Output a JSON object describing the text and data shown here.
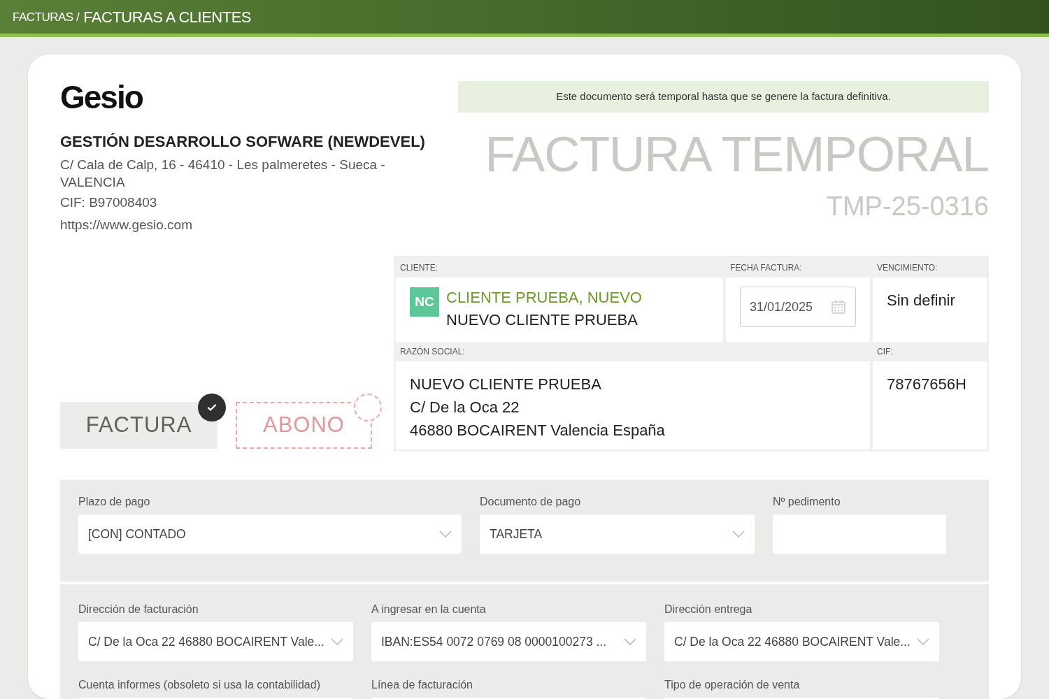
{
  "breadcrumb": {
    "parent": "FACTURAS /",
    "current": "FACTURAS A CLIENTES"
  },
  "company": {
    "logo": "Gesio",
    "name": "GESTIÓN DESARROLLO SOFWARE (NEWDEVEL)",
    "address": "C/ Cala de Calp, 16 - 46410 - Les palmeretes - Sueca - VALENCIA",
    "cif": "CIF: B97008403",
    "web": "https://www.gesio.com"
  },
  "notice": "Este documento será temporal hasta que se genere la factura definitiva.",
  "document": {
    "title": "FACTURA TEMPORAL",
    "number": "TMP-25-0316"
  },
  "document_types": [
    {
      "label": "FACTURA",
      "selected": true
    },
    {
      "label": "ABONO",
      "selected": false
    }
  ],
  "client": {
    "label": "CLIENTE:",
    "initials": "NC",
    "name": "CLIENTE PRUEBA, NUEVO",
    "subname": "NUEVO CLIENTE PRUEBA",
    "date_label": "FECHA FACTURA:",
    "date": "31/01/2025",
    "due_label": "VENCIMIENTO:",
    "due": "Sin definir",
    "business_label": "RAZÓN SOCIAL:",
    "business_lines": [
      "NUEVO CLIENTE PRUEBA",
      "C/ De la Oca 22",
      "46880 BOCAIRENT Valencia España"
    ],
    "cif_label": "CIF:",
    "cif": "78767656H"
  },
  "payment_fields": [
    {
      "label": "Plazo de pago",
      "kind": "select",
      "value": "[CON] CONTADO"
    },
    {
      "label": "Documento de pago",
      "kind": "select",
      "value": "TARJETA"
    },
    {
      "label": "Nº pedimento",
      "kind": "input"
    }
  ],
  "address_fields": [
    {
      "label": "Dirección de facturación",
      "kind": "select",
      "value": "C/ De la Oca 22 46880 BOCAIRENT Vale..."
    },
    {
      "label": "A ingresar en la cuenta",
      "kind": "select",
      "value": "IBAN:ES54 0072 0769 08 0000100273 ..."
    },
    {
      "label": "Dirección entrega",
      "kind": "select",
      "value": "C/ De la Oca 22 46880 BOCAIRENT Vale..."
    },
    {
      "label": "Cuenta informes (obsoleto si usa la contabilidad)",
      "kind": "input"
    },
    {
      "label": "Línea de facturación",
      "kind": "input"
    },
    {
      "label": "Tipo de operación de venta",
      "kind": "input"
    }
  ]
}
